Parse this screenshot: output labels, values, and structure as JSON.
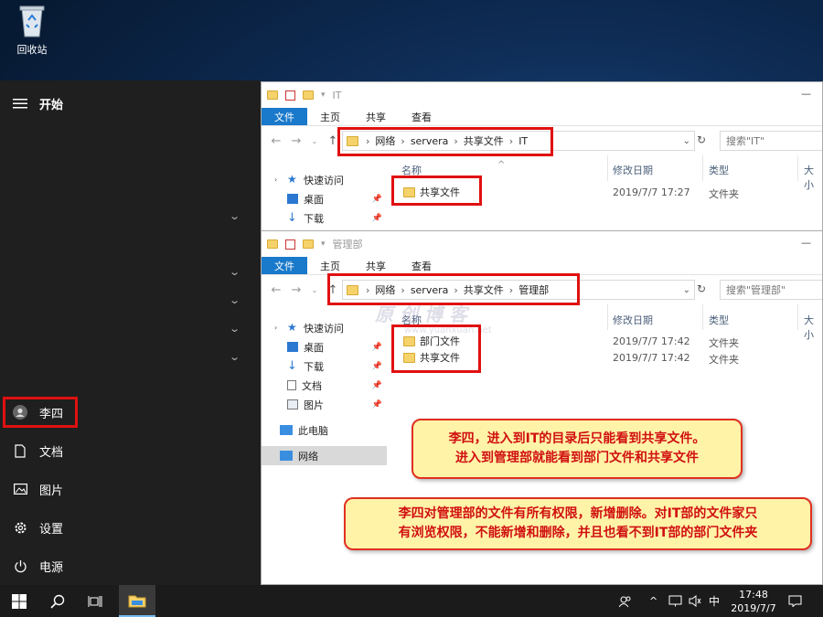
{
  "desktop": {
    "recycle_bin_label": "回收站",
    "watermark": "原 创 博 客",
    "watermark_url": "www.yuanxuan.net"
  },
  "start_menu": {
    "title": "开始",
    "user": "李四",
    "items": [
      {
        "label": "文档",
        "icon": "document-icon"
      },
      {
        "label": "图片",
        "icon": "picture-icon"
      },
      {
        "label": "设置",
        "icon": "gear-icon"
      },
      {
        "label": "电源",
        "icon": "power-icon"
      }
    ]
  },
  "ribbon_tabs": [
    "文件",
    "主页",
    "共享",
    "查看"
  ],
  "window_it": {
    "title": "IT",
    "path": [
      "网络",
      "servera",
      "共享文件",
      "IT"
    ],
    "search_placeholder": "搜索\"IT\"",
    "nav": [
      {
        "label": "快速访问",
        "icon": "star-icon"
      },
      {
        "label": "桌面",
        "icon": "desktop-icon"
      },
      {
        "label": "下载",
        "icon": "download-icon"
      }
    ],
    "columns": [
      "名称",
      "修改日期",
      "类型",
      "大小"
    ],
    "files": [
      {
        "name": "共享文件",
        "date": "2019/7/7 17:27",
        "type": "文件夹"
      }
    ]
  },
  "window_mgmt": {
    "title": "管理部",
    "path": [
      "网络",
      "servera",
      "共享文件",
      "管理部"
    ],
    "search_placeholder": "搜索\"管理部\"",
    "nav": [
      {
        "label": "快速访问",
        "icon": "star-icon"
      },
      {
        "label": "桌面",
        "icon": "desktop-icon"
      },
      {
        "label": "下载",
        "icon": "download-icon"
      },
      {
        "label": "文档",
        "icon": "document-icon"
      },
      {
        "label": "图片",
        "icon": "picture-icon"
      },
      {
        "label": "此电脑",
        "icon": "computer-icon"
      },
      {
        "label": "网络",
        "icon": "network-icon"
      }
    ],
    "columns": [
      "名称",
      "修改日期",
      "类型",
      "大小"
    ],
    "files": [
      {
        "name": "部门文件",
        "date": "2019/7/7 17:42",
        "type": "文件夹"
      },
      {
        "name": "共享文件",
        "date": "2019/7/7 17:42",
        "type": "文件夹"
      }
    ]
  },
  "callout1": {
    "line1": "李四，进入到IT的目录后只能看到共享文件。",
    "line2": "进入到管理部就能看到部门文件和共享文件"
  },
  "callout2": {
    "line1": "李四对管理部的文件有所有权限，新增删除。对IT部的文件家只",
    "line2": "有浏览权限，不能新增和删除，并且也看不到IT部的部门文件夹"
  },
  "taskbar": {
    "time": "17:48",
    "date": "2019/7/7",
    "ime": "中"
  }
}
